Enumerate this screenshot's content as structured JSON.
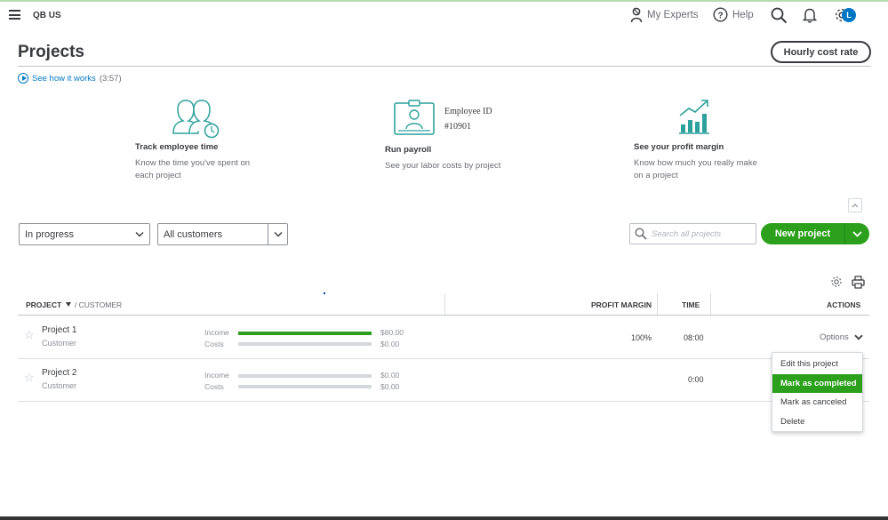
{
  "header": {
    "company": "QB US",
    "my_experts": "My Experts",
    "help": "Help",
    "avatar_initial": "L"
  },
  "page": {
    "title": "Projects",
    "hourly_cost_rate": "Hourly cost rate",
    "see_how": "See how it works",
    "see_how_duration": "(3:57)"
  },
  "features": [
    {
      "title": "Track employee time",
      "description": "Know the time you've spent on each project",
      "icon": "employees-icon"
    },
    {
      "title": "Run payroll",
      "description": "See your labor costs by project",
      "icon": "id-badge-icon",
      "badge_label": "Employee ID",
      "badge_number": "#10901"
    },
    {
      "title": "See your profit margin",
      "description": "Know how much you really make on a project",
      "icon": "growth-chart-icon"
    }
  ],
  "filters": {
    "status": "In progress",
    "customers": "All customers",
    "search_placeholder": "Search all projects",
    "new_project": "New project"
  },
  "table": {
    "headers": {
      "project": "PROJECT",
      "customer": "/ CUSTOMER",
      "profit_margin": "PROFIT MARGIN",
      "time": "TIME",
      "actions": "ACTIONS"
    },
    "rows": [
      {
        "name": "Project 1",
        "customer": "Customer",
        "income_label": "Income",
        "costs_label": "Costs",
        "income": "$80.00",
        "costs": "$0.00",
        "income_fill": 1.0,
        "costs_fill": 0.0,
        "profit_margin": "100%",
        "time": "08:00",
        "actions": "Options"
      },
      {
        "name": "Project 2",
        "customer": "Customer",
        "income_label": "Income",
        "costs_label": "Costs",
        "income": "$0.00",
        "costs": "$0.00",
        "income_fill": 0.0,
        "costs_fill": 0.0,
        "profit_margin": "",
        "time": "0:00",
        "actions": ""
      }
    ]
  },
  "menu": {
    "items": [
      "Edit this project",
      "Mark as completed",
      "Mark as canceled",
      "Delete"
    ],
    "active_index": 1
  },
  "colors": {
    "brand_green": "#2ca01c",
    "link_blue": "#0077c5",
    "text": "#393a3d"
  }
}
